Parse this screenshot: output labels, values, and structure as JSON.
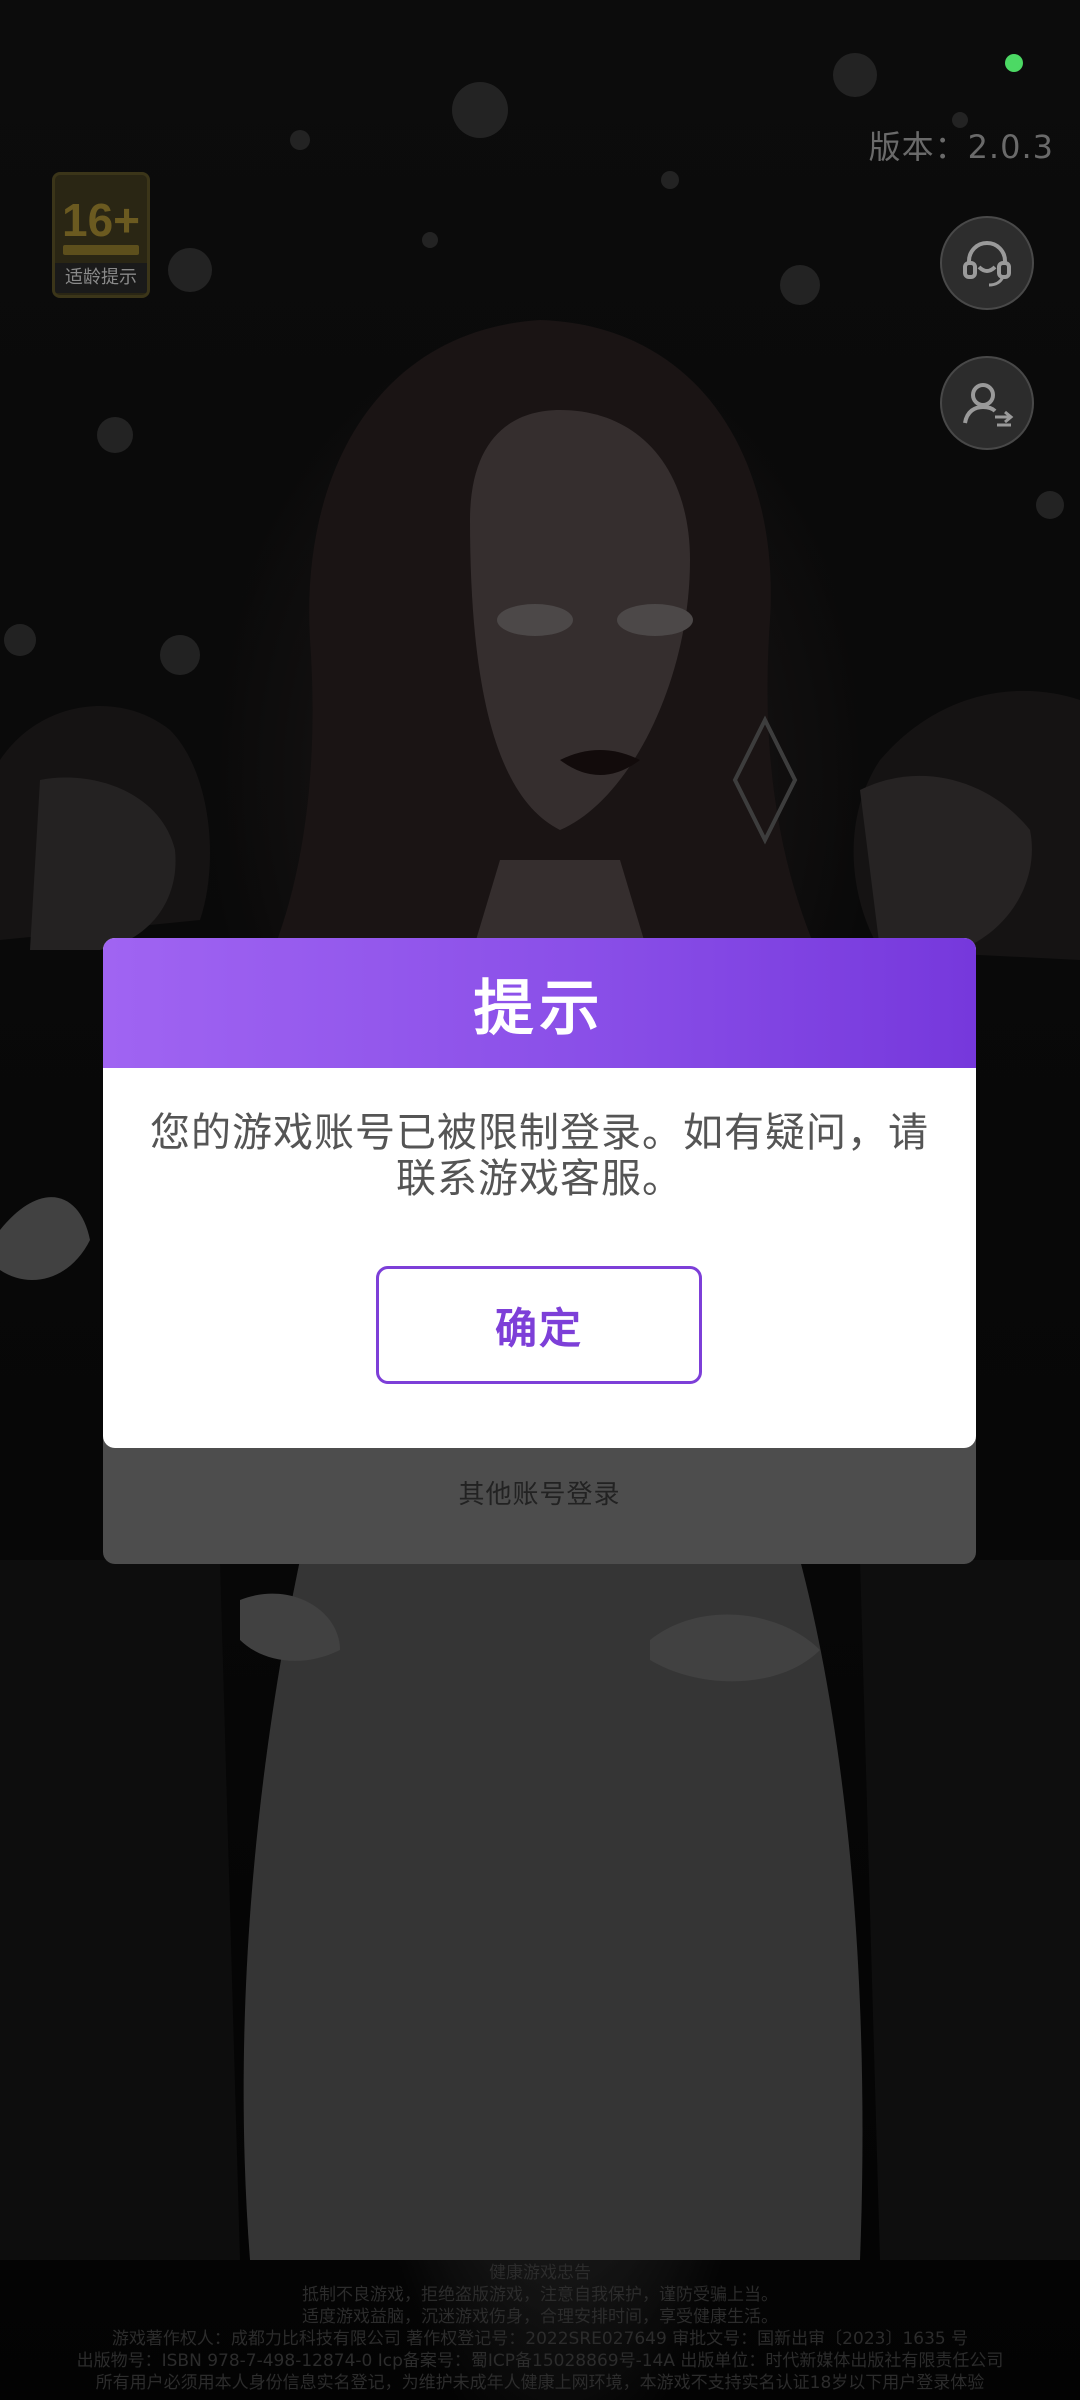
{
  "status_indicator": {
    "color": "#4cd964"
  },
  "version_text": "版本：2.0.3",
  "age_rating": {
    "number": "16+",
    "label": "适龄提示"
  },
  "side_buttons": {
    "customer_service_icon": "headset-icon",
    "account_switch_icon": "user-switch-icon"
  },
  "dialog": {
    "title": "提示",
    "message": "您的游戏账号已被限制登录。如有疑问，请联系游戏客服。",
    "confirm_label": "确定"
  },
  "other_login_label": "其他账号登录",
  "footer_lines": [
    "健康游戏忠告",
    "抵制不良游戏，拒绝盗版游戏，注意自我保护，谨防受骗上当。",
    "适度游戏益脑，沉迷游戏伤身，合理安排时间，享受健康生活。",
    "游戏著作权人：成都力比科技有限公司 著作权登记号：2022SRE027649 审批文号：国新出审〔2023〕1635 号",
    "出版物号：ISBN 978-7-498-12874-0 Icp备案号：蜀ICP备15028869号-14A 出版单位：时代新媒体出版社有限责任公司",
    "所有用户必须用本人身份信息实名登记，为维护未成年人健康上网环境，本游戏不支持实名认证18岁以下用户登录体验"
  ],
  "colors": {
    "accent": "#7d3fd8",
    "header_start": "#a064f2",
    "header_end": "#7638dc"
  }
}
